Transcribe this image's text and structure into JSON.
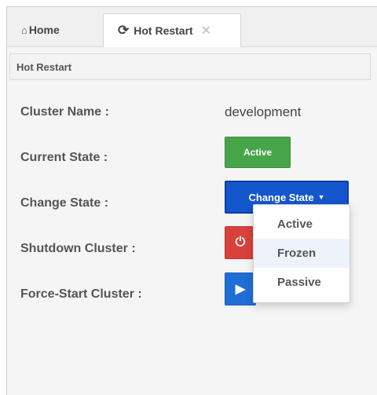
{
  "tabs": {
    "home_label": "Home",
    "restart_label": "Hot Restart"
  },
  "panel": {
    "title": "Hot Restart"
  },
  "form": {
    "cluster_name_label": "Cluster Name :",
    "cluster_name_value": "development",
    "current_state_label": "Current State :",
    "current_state_value": "Active",
    "change_state_label": "Change State :",
    "change_state_button": "Change State",
    "shutdown_label": "Shutdown Cluster :",
    "force_start_label": "Force-Start Cluster :"
  },
  "dropdown": {
    "options": [
      "Active",
      "Frozen",
      "Passive"
    ],
    "highlighted": "Frozen"
  },
  "colors": {
    "active_green": "#46a548",
    "change_blue": "#1456cc",
    "shutdown_red": "#d9413d",
    "force_blue": "#1f6ed6"
  },
  "icons": {
    "home": "home-icon",
    "restart": "refresh-icon",
    "close": "close-icon",
    "caret": "caret-down-icon",
    "shutdown": "power-icon",
    "force_start": "play-circle-icon"
  }
}
